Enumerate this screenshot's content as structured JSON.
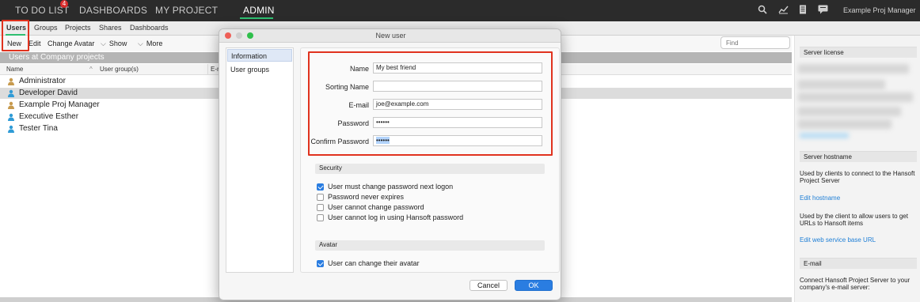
{
  "topnav": {
    "items": [
      {
        "label": "TO DO LIST",
        "badge": "4"
      },
      {
        "label": "DASHBOARDS"
      },
      {
        "label": "MY PROJECT"
      },
      {
        "label": "ADMIN"
      }
    ],
    "active": "ADMIN",
    "user": "Example Proj Manager",
    "icons": [
      "search-icon",
      "chart-icon",
      "document-icon",
      "chat-icon"
    ]
  },
  "subtabs": [
    "Users",
    "Groups",
    "Projects",
    "Shares",
    "Dashboards"
  ],
  "toolbar": {
    "new_label": "New",
    "edit_label": "Edit",
    "change_avatar_label": "Change Avatar",
    "show_label": "Show",
    "more_label": "More"
  },
  "search": {
    "placeholder": "Find"
  },
  "users_panel": {
    "title": "Users at Company projects",
    "columns": [
      "Name",
      "User group(s)",
      "E-m"
    ],
    "users": [
      {
        "name": "Administrator",
        "icon_color": "#c79a4e"
      },
      {
        "name": "Developer David",
        "icon_color": "#2f9bd6",
        "selected": true
      },
      {
        "name": "Example Proj Manager",
        "icon_color": "#c79a4e"
      },
      {
        "name": "Executive Esther",
        "icon_color": "#2f9bd6"
      },
      {
        "name": "Tester Tina",
        "icon_color": "#2f9bd6"
      }
    ]
  },
  "dialog": {
    "title": "New user",
    "nav": [
      "Information",
      "User groups"
    ],
    "fields": [
      {
        "label": "Name",
        "value": "My best friend"
      },
      {
        "label": "Sorting Name",
        "value": ""
      },
      {
        "label": "E-mail",
        "value": "joe@example.com"
      },
      {
        "label": "Password",
        "value": "••••••"
      },
      {
        "label": "Confirm Password",
        "value": "••••••"
      }
    ],
    "security_title": "Security",
    "security_options": [
      {
        "label": "User must change password next logon",
        "checked": true
      },
      {
        "label": "Password never expires",
        "checked": false
      },
      {
        "label": "User cannot change password",
        "checked": false
      },
      {
        "label": "User cannot log in using Hansoft password",
        "checked": false
      }
    ],
    "avatar_title": "Avatar",
    "avatar_options": [
      {
        "label": "User can change their avatar",
        "checked": true
      }
    ],
    "cancel_label": "Cancel",
    "ok_label": "OK"
  },
  "sidebar": {
    "license_title": "Server license",
    "hostname_title": "Server hostname",
    "hostname_desc": "Used by clients to connect to the Hansoft Project Server",
    "edit_hostname": "Edit hostname",
    "web_desc": "Used by the client to allow users to get URLs to Hansoft items",
    "edit_web": "Edit web service base URL",
    "email_title": "E-mail",
    "email_desc": "Connect Hansoft Project Server to your company's e-mail server:"
  },
  "colors": {
    "accent_green": "#2fbf71",
    "highlight_red": "#e0321e",
    "ok_blue": "#2a7de1"
  }
}
